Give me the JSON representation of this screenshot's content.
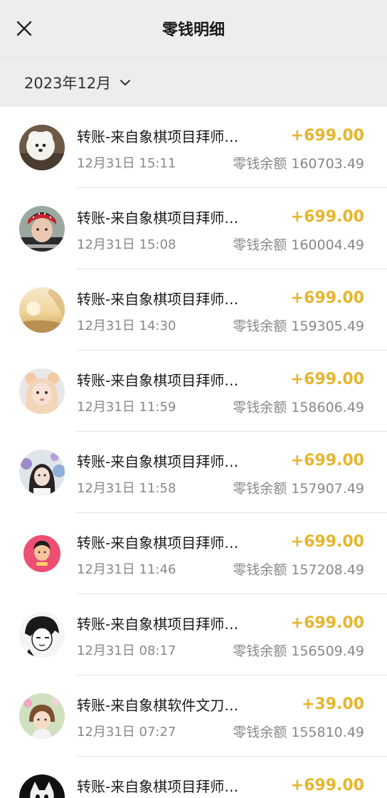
{
  "header": {
    "title": "零钱明细",
    "close_icon": "close-icon"
  },
  "filter": {
    "month": "2023年12月",
    "chevron_icon": "chevron-down-icon"
  },
  "colors": {
    "amount": "#e6b52d",
    "background": "#ededed"
  },
  "transactions": [
    {
      "desc": "转账-来自象棋项目拜师…",
      "amount": "+699.00",
      "time": "12月31日 15:11",
      "balance": "零钱余额 160703.49",
      "avatar": "white-puppy"
    },
    {
      "desc": "转账-来自象棋项目拜师…",
      "amount": "+699.00",
      "time": "12月31日 15:08",
      "balance": "零钱余额 160004.49",
      "avatar": "boy-red-headband"
    },
    {
      "desc": "转账-来自象棋项目拜师…",
      "amount": "+699.00",
      "time": "12月31日 14:30",
      "balance": "零钱余额 159305.49",
      "avatar": "sunset-landscape"
    },
    {
      "desc": "转账-来自象棋项目拜师…",
      "amount": "+699.00",
      "time": "12月31日 11:59",
      "balance": "零钱余额 158606.49",
      "avatar": "girl-bear-ears"
    },
    {
      "desc": "转账-来自象棋项目拜师…",
      "amount": "+699.00",
      "time": "12月31日 11:58",
      "balance": "零钱余额 157907.49",
      "avatar": "girl-flowers"
    },
    {
      "desc": "转账-来自象棋项目拜师…",
      "amount": "+699.00",
      "time": "12月31日 11:46",
      "balance": "零钱余额 157208.49",
      "avatar": "cartoon-pink"
    },
    {
      "desc": "转账-来自象棋项目拜师…",
      "amount": "+699.00",
      "time": "12月31日 08:17",
      "balance": "零钱余额 156509.49",
      "avatar": "anime-sketch"
    },
    {
      "desc": "转账-来自象棋软件文刀…",
      "amount": "+39.00",
      "time": "12月31日 07:27",
      "balance": "零钱余额 155810.49",
      "avatar": "child-flowers"
    },
    {
      "desc": "转账-来自象棋项目拜师…",
      "amount": "+699.00",
      "time": "",
      "balance": "",
      "avatar": "black-white-cat"
    }
  ]
}
